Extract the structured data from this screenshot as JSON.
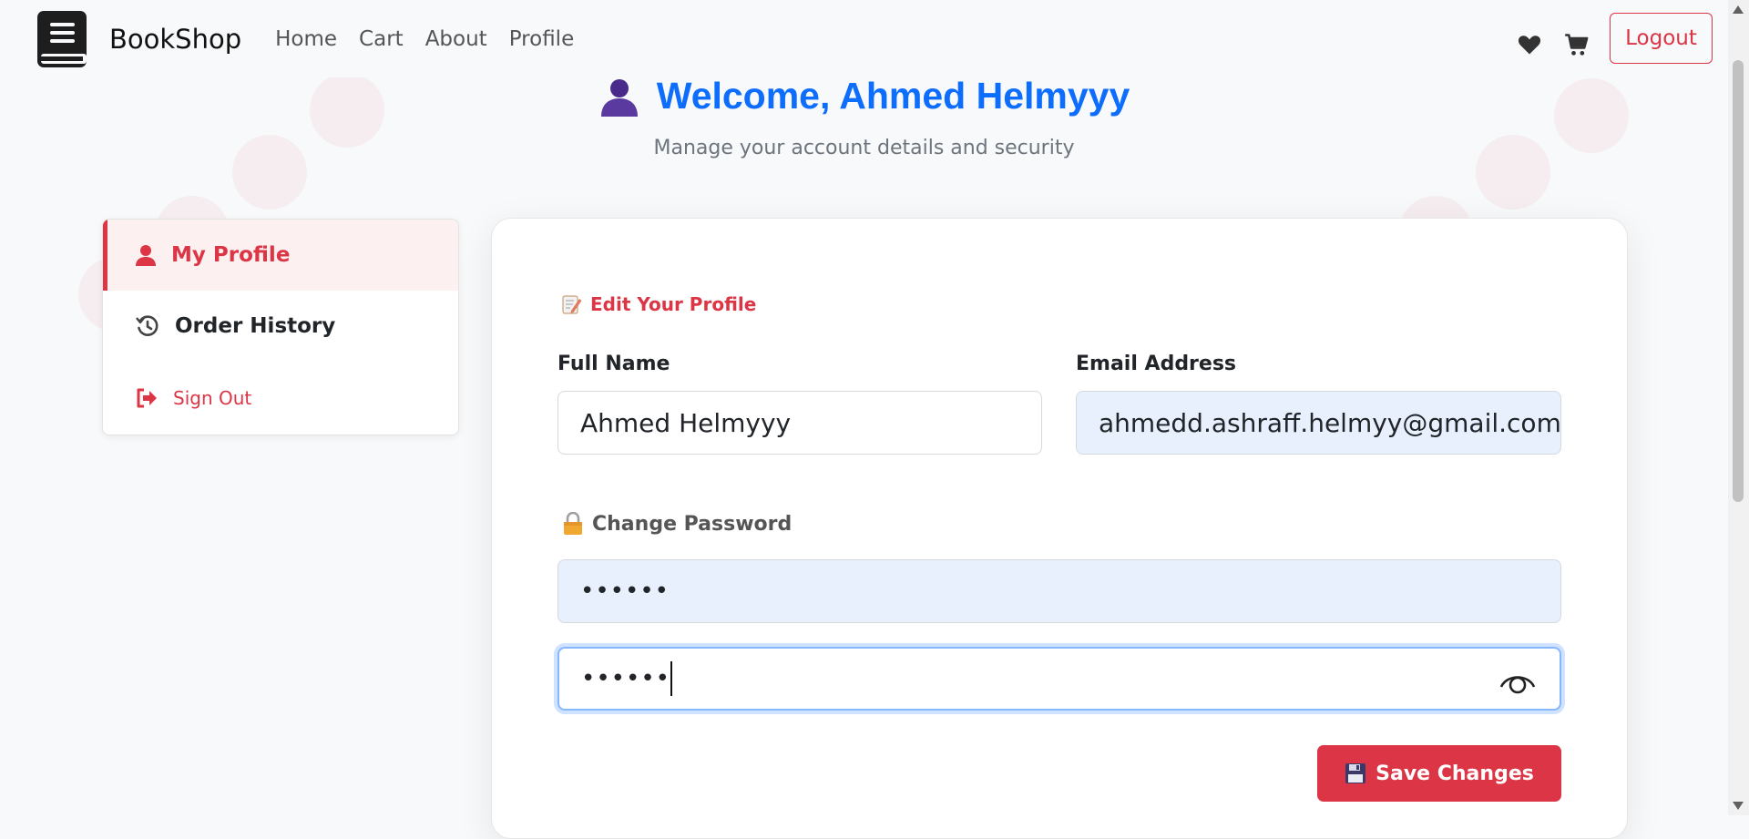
{
  "navbar": {
    "brand": "BookShop",
    "links": [
      "Home",
      "Cart",
      "About",
      "Profile"
    ],
    "icons": [
      "heart-icon",
      "cart-icon"
    ],
    "logout_label": "Logout"
  },
  "header": {
    "title": "Welcome, Ahmed Helmyyy",
    "subtitle": "Manage your account details and security"
  },
  "sidebar": {
    "items": [
      {
        "label": "My Profile",
        "icon": "user-icon",
        "active": true
      },
      {
        "label": "Order History",
        "icon": "history-icon",
        "active": false
      },
      {
        "label": "Sign Out",
        "icon": "sign-out-icon",
        "active": false
      }
    ]
  },
  "profile_form": {
    "section_title": "Edit Your Profile",
    "full_name_label": "Full Name",
    "full_name_value": "Ahmed Helmyyy",
    "email_label": "Email Address",
    "email_value": "ahmedd.ashraff.helmyy@gmail.com",
    "password_section_title": "Change Password",
    "current_password_value": "••••••",
    "new_password_value": "••••••",
    "save_label": "Save Changes"
  },
  "colors": {
    "accent": "#dc3545",
    "primary": "#0d6efd",
    "autofill": "#e8f0fe"
  }
}
